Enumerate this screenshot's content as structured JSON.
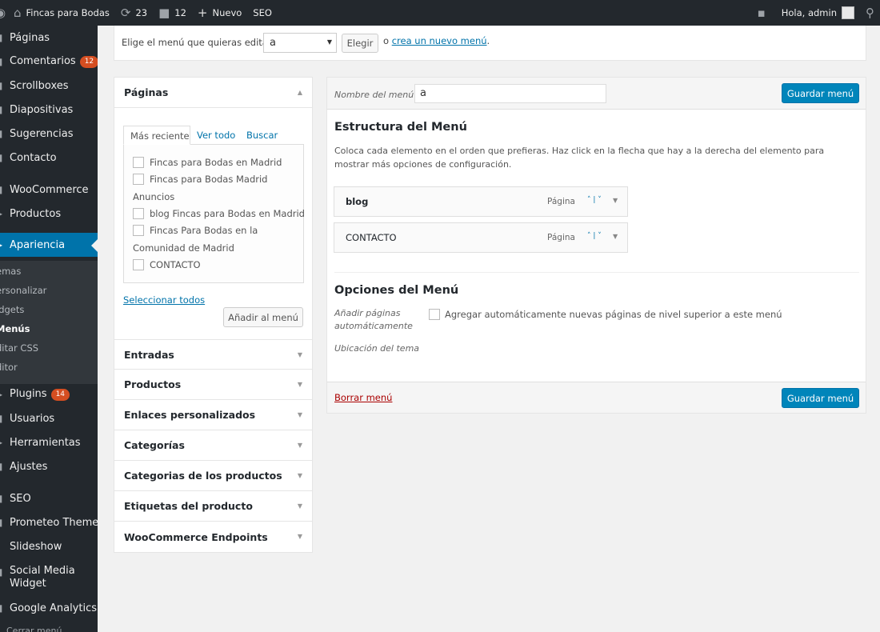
{
  "adminbar": {
    "site_name": "Fincas para Bodas",
    "updates_count": "23",
    "comments_count": "12",
    "new_label": "Nuevo",
    "seo_label": "SEO",
    "greeting": "Hola, admin"
  },
  "sidebar": {
    "items": [
      {
        "label": "Páginas"
      },
      {
        "label": "Comentarios",
        "badge": "12"
      },
      {
        "label": "Scrollboxes"
      },
      {
        "label": "Diapositivas"
      },
      {
        "label": "Sugerencias"
      },
      {
        "label": "Contacto"
      },
      {
        "label": "WooCommerce"
      },
      {
        "label": "Productos"
      },
      {
        "label": "Apariencia"
      },
      {
        "label": "Plugins",
        "badge": "14"
      },
      {
        "label": "Usuarios"
      },
      {
        "label": "Herramientas"
      },
      {
        "label": "Ajustes"
      },
      {
        "label": "SEO"
      },
      {
        "label": "Prometeo Theme"
      },
      {
        "label": "Slideshow"
      },
      {
        "label": "Social Media Widget"
      },
      {
        "label": "Google Analytics"
      }
    ],
    "submenu": [
      "emas",
      "ersonalizar",
      "idgets",
      "Menús",
      "ditar CSS",
      "ditor"
    ],
    "collapse_label": "Cerrar menú"
  },
  "select_bar": {
    "label": "Elige el menú que quieras editar:",
    "selected": "a",
    "button": "Elegir",
    "or_text": "o",
    "create_link": "crea un nuevo menú",
    "period": "."
  },
  "left_panel": {
    "pages_title": "Páginas",
    "tabs": [
      "Más reciente",
      "Ver todo",
      "Buscar"
    ],
    "pages": [
      {
        "text": "Fincas para Bodas en Madrid",
        "checkbox": true
      },
      {
        "text": "Fincas para Bodas Madrid",
        "checkbox": true
      },
      {
        "text": "Anuncios",
        "checkbox": false
      },
      {
        "text": "blog Fincas para Bodas en Madrid",
        "checkbox": true
      },
      {
        "text": "Fincas Para Bodas en la",
        "checkbox": true
      },
      {
        "text": "Comunidad de Madrid",
        "checkbox": false
      },
      {
        "text": "CONTACTO",
        "checkbox": true
      }
    ],
    "select_all": "Seleccionar todos",
    "add_button": "Añadir al menú",
    "sections": [
      "Entradas",
      "Productos",
      "Enlaces personalizados",
      "Categorías",
      "Categorias de los productos",
      "Etiquetas del producto",
      "WooCommerce Endpoints"
    ]
  },
  "editor": {
    "name_label": "Nombre del menú",
    "name_value": "a",
    "save_label": "Guardar menú",
    "structure_title": "Estructura del Menú",
    "structure_desc": "Coloca cada elemento en el orden que prefieras. Haz click en la flecha que hay a la derecha del elemento para mostrar más opciones de configuración.",
    "items": [
      {
        "title": "blog",
        "type": "Página"
      },
      {
        "title": "CONTACTO",
        "type": "Página"
      }
    ],
    "options_title": "Opciones del Menú",
    "auto_add_label": "Añadir páginas automáticamente",
    "auto_add_text": "Agregar automáticamente nuevas páginas de nivel superior a este menú",
    "location_label": "Ubicación del tema",
    "delete_label": "Borrar menú"
  }
}
